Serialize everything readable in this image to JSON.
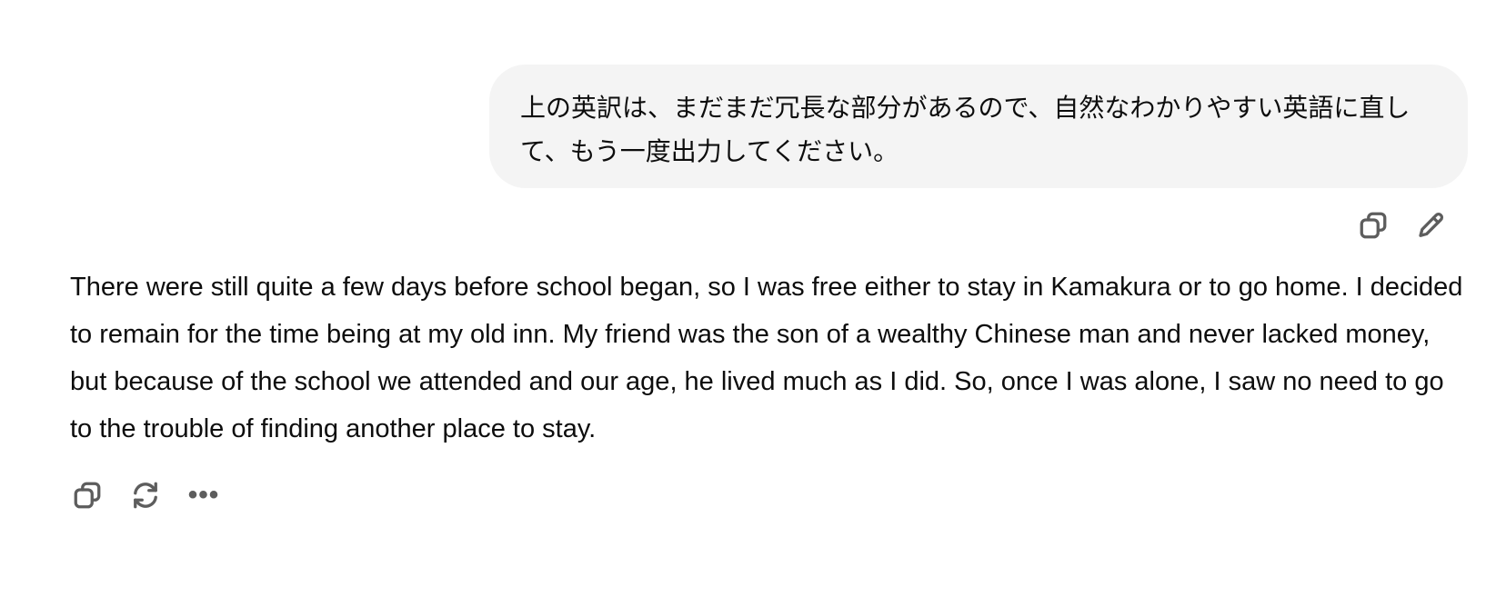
{
  "user_message": {
    "text": "上の英訳は、まだまだ冗長な部分があるので、自然なわかりやすい英語に直して、もう一度出力してください。"
  },
  "user_actions": {
    "copy_icon": "copy-icon",
    "edit_icon": "pencil-icon"
  },
  "assistant_message": {
    "text": "There were still quite a few days before school began, so I was free either to stay in Kamakura or to go home. I decided to remain for the time being at my old inn. My friend was the son of a wealthy Chinese man and never lacked money, but because of the school we attended and our age, he lived much as I did. So, once I was alone, I saw no need to go to the trouble of finding another place to stay."
  },
  "assistant_actions": {
    "copy_icon": "copy-icon",
    "regenerate_icon": "refresh-icon",
    "more_label": "•••"
  },
  "colors": {
    "bubble_bg": "#f4f4f4",
    "icon": "#5d5d5d",
    "text": "#0d0d0d"
  }
}
